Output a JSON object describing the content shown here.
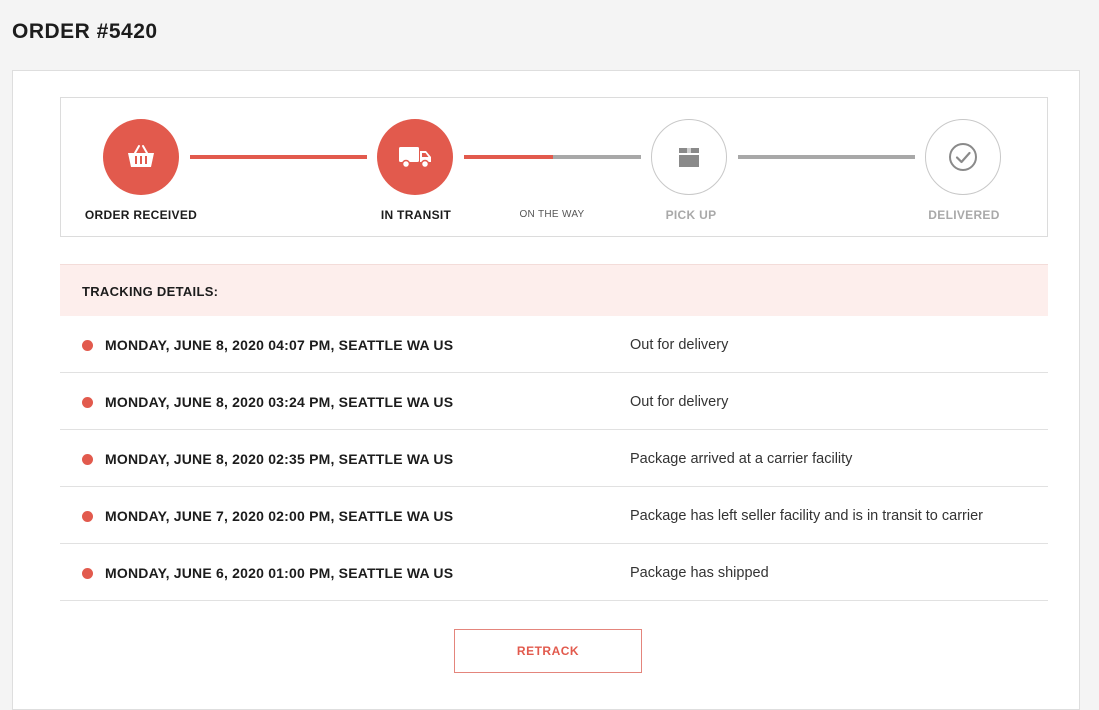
{
  "page": {
    "title": "ORDER #5420"
  },
  "progress": {
    "steps": [
      {
        "label": "ORDER RECEIVED",
        "icon": "basket-icon",
        "state": "completed"
      },
      {
        "label": "IN TRANSIT",
        "icon": "truck-icon",
        "state": "current"
      },
      {
        "label": "PICK UP",
        "icon": "box-icon",
        "state": "pending"
      },
      {
        "label": "DELIVERED",
        "icon": "check-circle-icon",
        "state": "pending"
      }
    ],
    "in_progress_label": "ON THE WAY",
    "in_progress_fraction": 0.5
  },
  "colors": {
    "accent": "#e25a4d",
    "pending_line": "#a8a8a8",
    "header_bg": "#fdeeec"
  },
  "tracking": {
    "header": "TRACKING DETAILS:",
    "events": [
      {
        "datetime": "MONDAY, JUNE 8, 2020 04:07 PM, SEATTLE WA US",
        "status": "Out for delivery"
      },
      {
        "datetime": "MONDAY, JUNE 8, 2020 03:24 PM, SEATTLE WA US",
        "status": "Out for delivery"
      },
      {
        "datetime": "MONDAY, JUNE 8, 2020 02:35 PM, SEATTLE WA US",
        "status": "Package arrived at a carrier facility"
      },
      {
        "datetime": "MONDAY, JUNE 7, 2020 02:00 PM, SEATTLE WA US",
        "status": "Package has left seller facility and is in transit to carrier"
      },
      {
        "datetime": "MONDAY, JUNE 6, 2020 01:00 PM, SEATTLE WA US",
        "status": "Package has shipped"
      }
    ]
  },
  "actions": {
    "retrack_label": "RETRACK"
  }
}
